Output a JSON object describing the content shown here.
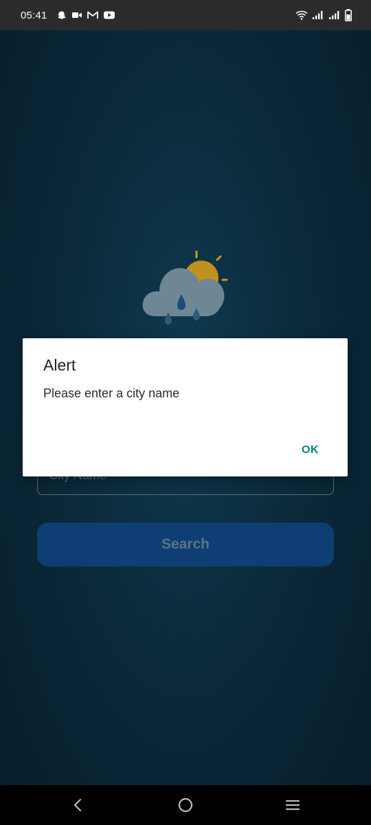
{
  "status_bar": {
    "time": "05:41",
    "left_icons": [
      "snapchat-icon",
      "video-icon",
      "gmail-icon",
      "youtube-icon"
    ],
    "right_icons": [
      "wifi-icon",
      "signal-icon",
      "signal-icon",
      "battery-icon"
    ]
  },
  "main": {
    "city_input": {
      "placeholder": "City Name"
    },
    "search_button": {
      "label": "Search"
    }
  },
  "dialog": {
    "title": "Alert",
    "message": "Please enter a city name",
    "ok_label": "OK"
  },
  "nav_bar": {
    "icons": [
      "back-icon",
      "home-icon",
      "recents-icon"
    ]
  },
  "colors": {
    "background": "#0b2a3b",
    "button": "#0e3e73",
    "accent": "#00897b",
    "sun": "#e0a823",
    "cloud": "#6f8795"
  }
}
